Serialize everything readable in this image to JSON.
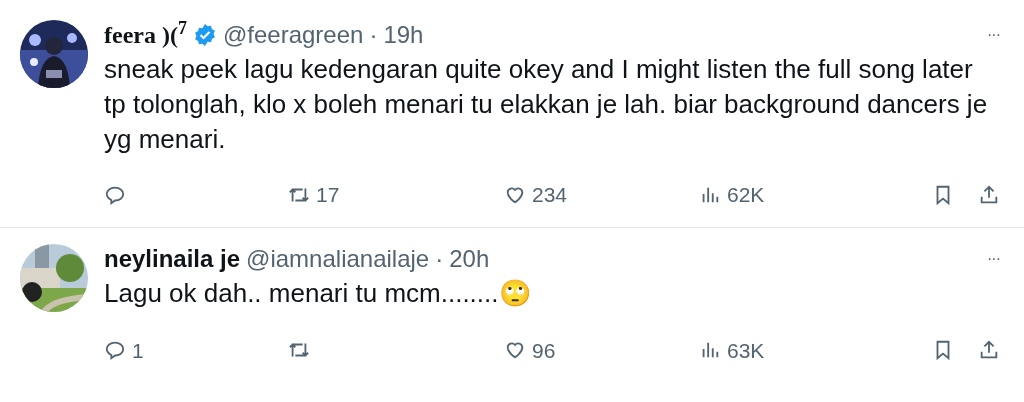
{
  "tweets": [
    {
      "name": "feera )($^{7}$",
      "verified": true,
      "handle": "@feeragreen",
      "separator": "·",
      "time": "19h",
      "more": "···",
      "text": "sneak peek lagu kedengaran quite okey and I might listen the full song later tp tolonglah, klo x boleh menari tu elakkan je lah. biar background dancers je yg menari.",
      "reposts": "17",
      "likes": "234",
      "views": "62K"
    },
    {
      "name": "neylinaila je",
      "verified": false,
      "handle": "@iamnalianailaje",
      "separator": "·",
      "time": "20h",
      "more": "···",
      "text": "Lagu ok dah.. menari tu mcm........🙄",
      "replies": "1",
      "likes": "96",
      "views": "63K"
    }
  ]
}
